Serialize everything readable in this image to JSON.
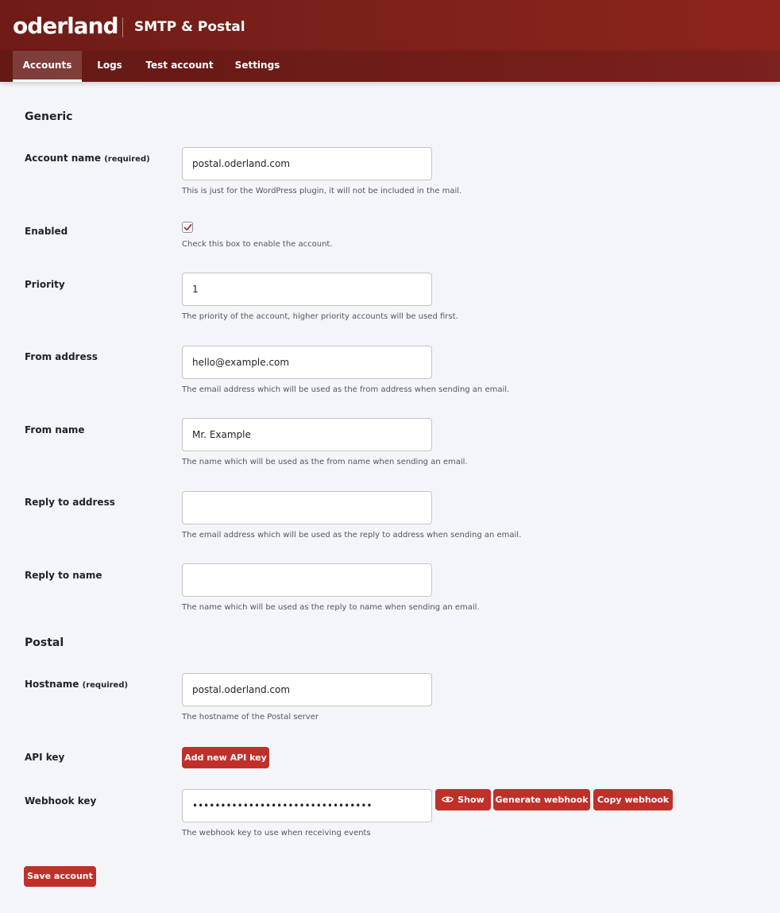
{
  "app": {
    "logo_text": "oderland",
    "title": "SMTP & Postal"
  },
  "nav": {
    "tabs": [
      {
        "label": "Accounts",
        "active": true
      },
      {
        "label": "Logs",
        "active": false
      },
      {
        "label": "Test account",
        "active": false
      },
      {
        "label": "Settings",
        "active": false
      }
    ]
  },
  "generic": {
    "title": "Generic",
    "account_name": {
      "label": "Account name",
      "required": "(required)",
      "value": "postal.oderland.com",
      "help": "This is just for the WordPress plugin, it will not be included in the mail."
    },
    "enabled": {
      "label": "Enabled",
      "checked": true,
      "help": "Check this box to enable the account."
    },
    "priority": {
      "label": "Priority",
      "value": "1",
      "help": "The priority of the account, higher priority accounts will be used first."
    },
    "from_address": {
      "label": "From address",
      "value": "hello@example.com",
      "help": "The email address which will be used as the from address when sending an email."
    },
    "from_name": {
      "label": "From name",
      "value": "Mr. Example",
      "help": "The name which will be used as the from name when sending an email."
    },
    "reply_to_address": {
      "label": "Reply to address",
      "value": "",
      "help": "The email address which will be used as the reply to address when sending an email."
    },
    "reply_to_name": {
      "label": "Reply to name",
      "value": "",
      "help": "The name which will be used as the reply to name when sending an email."
    }
  },
  "postal": {
    "title": "Postal",
    "hostname": {
      "label": "Hostname",
      "required": "(required)",
      "value": "postal.oderland.com",
      "help": "The hostname of the Postal server"
    },
    "api_key": {
      "label": "API key",
      "button": "Add new API key"
    },
    "webhook_key": {
      "label": "Webhook key",
      "value": "••••••••••••••••••••••••••••••••",
      "show_button": "Show",
      "generate_button": "Generate webhook",
      "copy_button": "Copy webhook",
      "help": "The webhook key to use when receiving events"
    }
  },
  "save_button": "Save account",
  "colors": {
    "brand": "#7e211b",
    "button": "#c0302a",
    "background": "#f4f5f9"
  }
}
